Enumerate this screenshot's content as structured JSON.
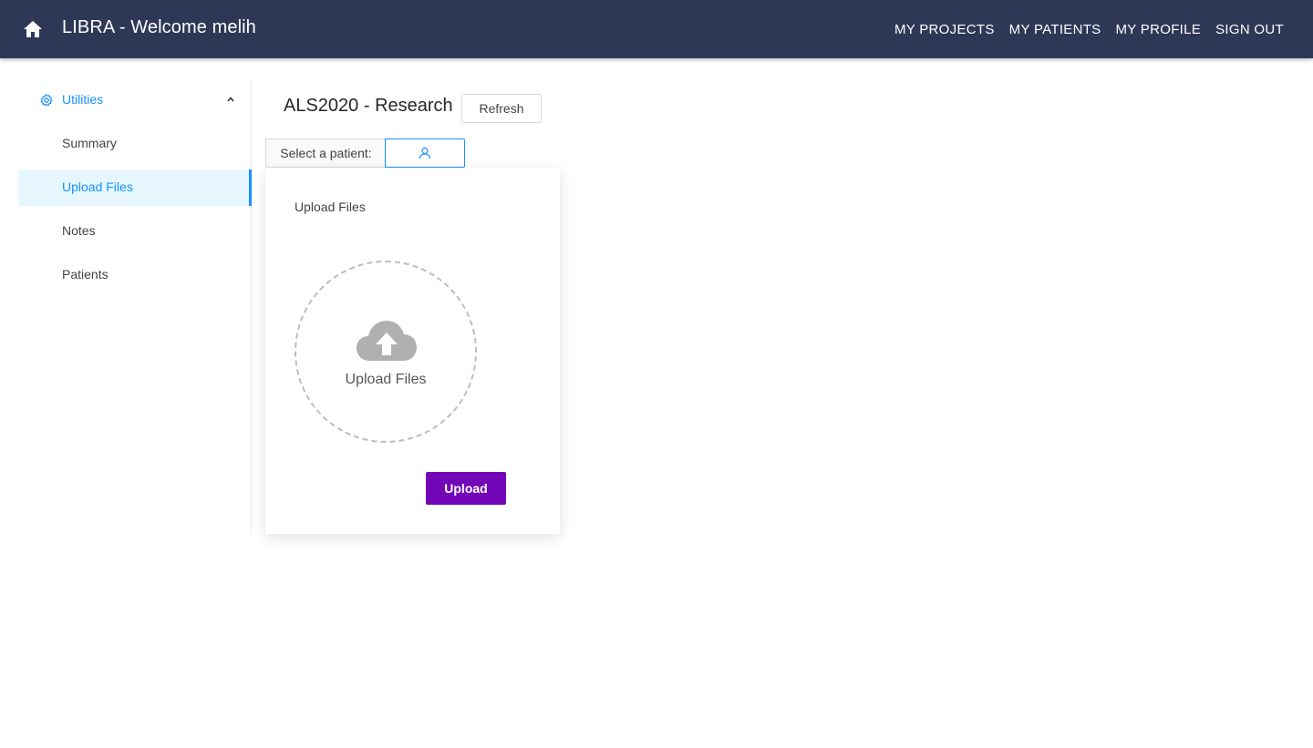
{
  "header": {
    "title": "LIBRA - Welcome melih",
    "home_icon": "home-icon",
    "nav": [
      {
        "label": "MY PROJECTS"
      },
      {
        "label": "MY PATIENTS"
      },
      {
        "label": "MY PROFILE"
      },
      {
        "label": "SIGN OUT"
      }
    ]
  },
  "sidebar": {
    "group": {
      "label": "Utilities",
      "icon": "gear-icon",
      "expanded": true
    },
    "items": [
      {
        "label": "Summary",
        "active": false
      },
      {
        "label": "Upload Files",
        "active": true
      },
      {
        "label": "Notes",
        "active": false
      },
      {
        "label": "Patients",
        "active": false
      }
    ]
  },
  "main": {
    "project_title": "ALS2020 - Research",
    "refresh_label": "Refresh",
    "patient_select_label": "Select a patient:",
    "patient_select_icon": "user-icon"
  },
  "upload_card": {
    "title": "Upload Files",
    "dropzone_label": "Upload Files",
    "dropzone_icon": "cloud-upload-icon",
    "upload_button_label": "Upload"
  },
  "colors": {
    "header_bg": "#2e3856",
    "accent": "#1890ff",
    "active_item_bg": "#e6f7ff",
    "upload_button": "#7307b8"
  }
}
